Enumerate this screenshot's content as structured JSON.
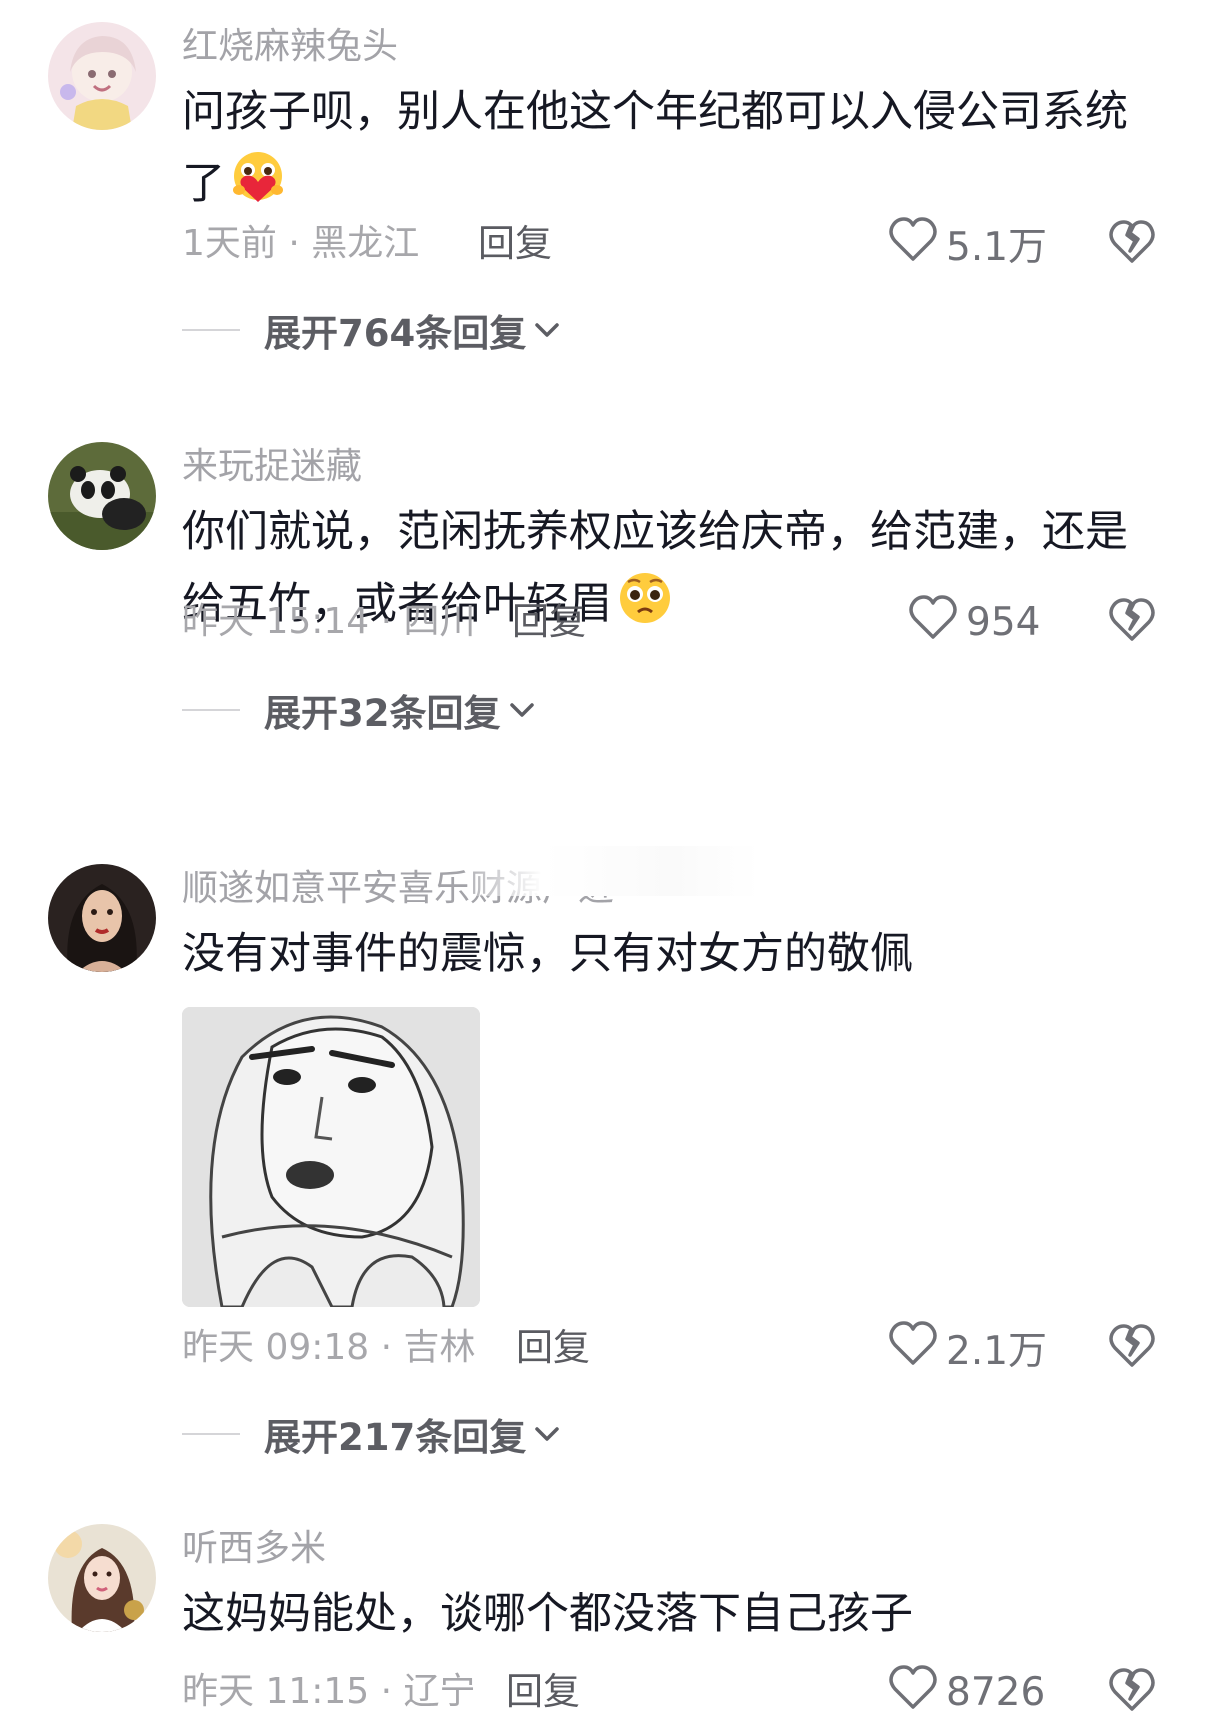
{
  "comments": [
    {
      "username": "红烧麻辣兔头",
      "text": "问孩子呗，别人在他这个年纪都可以入侵公司系统了",
      "emoji": "hug-heart-emoji",
      "time": "1天前 · 黑龙江",
      "reply_label": "回复",
      "likes": "5.1万",
      "expand_label": "展开764条回复"
    },
    {
      "username": "来玩捉迷藏",
      "text": "你们就说，范闲抚养权应该给庆帝，给范建，还是给五竹，或者给叶轻眉",
      "emoji": "pleading-face-emoji",
      "time": "昨天 15:14 · 四川",
      "reply_label": "回复",
      "likes": "954",
      "expand_label": "展开32条回复"
    },
    {
      "username": "顺遂如意平安喜乐财源广进",
      "text": "没有对事件的震惊，只有对女方的敬佩",
      "image": "shocked-face-sketch-meme",
      "time": "昨天 09:18 · 吉林",
      "reply_label": "回复",
      "likes": "2.1万",
      "expand_label": "展开217条回复"
    },
    {
      "username": "听西多米",
      "text": "这妈妈能处，谈哪个都没落下自己孩子",
      "time": "昨天 11:15 · 辽宁",
      "reply_label": "回复",
      "likes": "8726"
    }
  ],
  "colors": {
    "text": "#161823",
    "meta": "#a7a7ab",
    "username": "#a3a3a8",
    "expand": "#5c5d63"
  },
  "icons": [
    "heart-outline-icon",
    "broken-heart-icon",
    "chevron-down-icon"
  ]
}
